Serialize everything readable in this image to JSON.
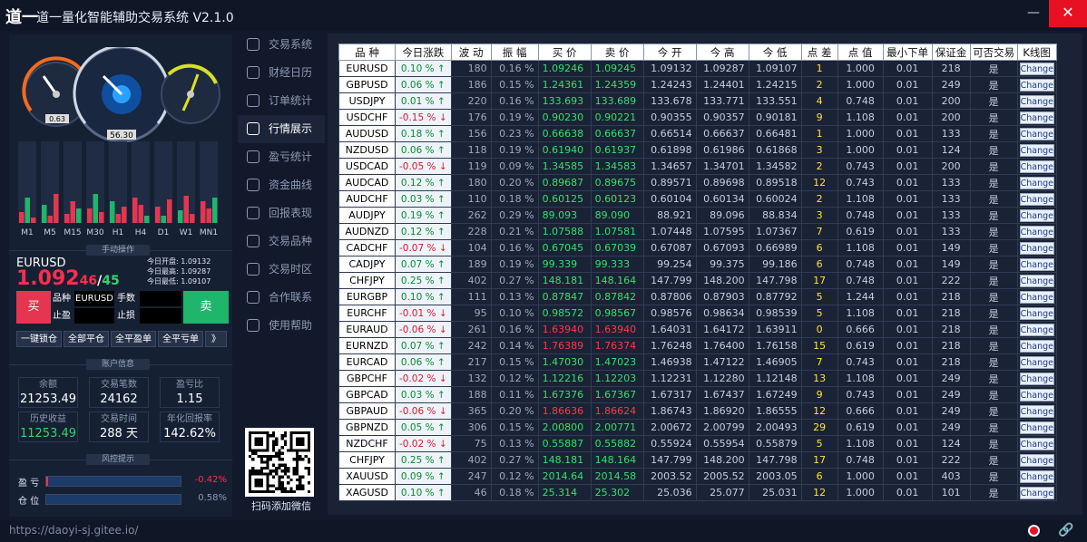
{
  "app": {
    "logo_text": "道一",
    "title": "道一量化智能辅助交易系统 V2.1.0",
    "min": "—",
    "close": "✕"
  },
  "gauges": {
    "left_value": "0.63",
    "mid_value": "56.30"
  },
  "timeframes": [
    "M1",
    "M5",
    "M15",
    "M30",
    "H1",
    "H4",
    "D1",
    "W1",
    "MN1"
  ],
  "trade_panel": {
    "header": "手动操作",
    "symbol": "EURUSD",
    "price_main": "1.092",
    "price_sub1": "46",
    "price_sep": "/",
    "price_sub2": "45",
    "day_open_label": "今日开盘: 1.09132",
    "day_high_label": "今日最高: 1.09287",
    "day_low_label": "今日最低: 1.09107",
    "buy": "买",
    "sell": "卖",
    "symbol_label": "品种",
    "symbol_value": "EURUSD",
    "lots_label": "手数",
    "tp_label": "止盈",
    "sl_label": "止损",
    "ops": [
      "一键锁仓",
      "全部平仓",
      "全平盈单",
      "全平亏单",
      "》"
    ]
  },
  "account": {
    "header": "账户信息",
    "stats": [
      {
        "k": "余额",
        "v": "21253.49",
        "green": false
      },
      {
        "k": "交易笔数",
        "v": "24162",
        "green": false
      },
      {
        "k": "盈亏比",
        "v": "1.15",
        "green": false
      },
      {
        "k": "历史收益",
        "v": "11253.49",
        "green": true
      },
      {
        "k": "交易时间",
        "v": "288 天",
        "green": false
      },
      {
        "k": "年化回报率",
        "v": "142.62%",
        "green": false
      }
    ]
  },
  "risk": {
    "header": "风控提示",
    "pl_label": "盈 亏",
    "pl_value": "-0.42%",
    "pl_color": "#ff2d4d",
    "pos_label": "仓 位",
    "pos_value": "0.58%",
    "pos_color": "#8d9bb5"
  },
  "nav": [
    "交易系统",
    "财经日历",
    "订单统计",
    "行情展示",
    "盈亏统计",
    "资金曲线",
    "回报表现",
    "交易品种",
    "交易时区",
    "合作联系",
    "使用帮助"
  ],
  "nav_active": 3,
  "qr_caption": "扫码添加微信",
  "table": {
    "headers": [
      "品 种",
      "今日涨跌",
      "波 动",
      "振 幅",
      "买 价",
      "卖 价",
      "今 开",
      "今 高",
      "今 低",
      "点 差",
      "点 值",
      "最小下单",
      "保证金",
      "可否交易",
      "K线图"
    ],
    "change_label": "Change",
    "rows": [
      [
        "EURUSD",
        "0.10 % ↑",
        "180",
        "0.16 %",
        "1.09246",
        "1.09245",
        "1.09132",
        "1.09287",
        "1.09107",
        "1",
        "1.000",
        "0.01",
        "218",
        "是"
      ],
      [
        "GBPUSD",
        "0.06 % ↑",
        "186",
        "0.15 %",
        "1.24361",
        "1.24359",
        "1.24243",
        "1.24401",
        "1.24215",
        "2",
        "1.000",
        "0.01",
        "249",
        "是"
      ],
      [
        "USDJPY",
        "0.01 % ↑",
        "220",
        "0.16 %",
        "133.693",
        "133.689",
        "133.678",
        "133.771",
        "133.551",
        "4",
        "0.748",
        "0.01",
        "200",
        "是"
      ],
      [
        "USDCHF",
        "-0.15 % ↓",
        "176",
        "0.19 %",
        "0.90230",
        "0.90221",
        "0.90355",
        "0.90357",
        "0.90181",
        "9",
        "1.108",
        "0.01",
        "200",
        "是"
      ],
      [
        "AUDUSD",
        "0.18 % ↑",
        "156",
        "0.23 %",
        "0.66638",
        "0.66637",
        "0.66514",
        "0.66637",
        "0.66481",
        "1",
        "1.000",
        "0.01",
        "133",
        "是"
      ],
      [
        "NZDUSD",
        "0.06 % ↑",
        "118",
        "0.19 %",
        "0.61940",
        "0.61937",
        "0.61898",
        "0.61986",
        "0.61868",
        "3",
        "1.000",
        "0.01",
        "124",
        "是"
      ],
      [
        "USDCAD",
        "-0.05 % ↓",
        "119",
        "0.09 %",
        "1.34585",
        "1.34583",
        "1.34657",
        "1.34701",
        "1.34582",
        "2",
        "0.743",
        "0.01",
        "200",
        "是"
      ],
      [
        "AUDCAD",
        "0.12 % ↑",
        "180",
        "0.20 %",
        "0.89687",
        "0.89675",
        "0.89571",
        "0.89698",
        "0.89518",
        "12",
        "0.743",
        "0.01",
        "133",
        "是"
      ],
      [
        "AUDCHF",
        "0.03 % ↑",
        "110",
        "0.18 %",
        "0.60125",
        "0.60123",
        "0.60104",
        "0.60134",
        "0.60024",
        "2",
        "1.108",
        "0.01",
        "133",
        "是"
      ],
      [
        "AUDJPY",
        "0.19 % ↑",
        "262",
        "0.29 %",
        "89.093",
        "89.090",
        "88.921",
        "89.096",
        "88.834",
        "3",
        "0.748",
        "0.01",
        "133",
        "是"
      ],
      [
        "AUDNZD",
        "0.12 % ↑",
        "228",
        "0.21 %",
        "1.07588",
        "1.07581",
        "1.07448",
        "1.07595",
        "1.07367",
        "7",
        "0.619",
        "0.01",
        "133",
        "是"
      ],
      [
        "CADCHF",
        "-0.07 % ↓",
        "104",
        "0.16 %",
        "0.67045",
        "0.67039",
        "0.67087",
        "0.67093",
        "0.66989",
        "6",
        "1.108",
        "0.01",
        "149",
        "是"
      ],
      [
        "CADJPY",
        "0.07 % ↑",
        "189",
        "0.19 %",
        "99.339",
        "99.333",
        "99.254",
        "99.375",
        "99.186",
        "6",
        "0.748",
        "0.01",
        "149",
        "是"
      ],
      [
        "CHFJPY",
        "0.25 % ↑",
        "402",
        "0.27 %",
        "148.181",
        "148.164",
        "147.799",
        "148.200",
        "147.798",
        "17",
        "0.748",
        "0.01",
        "222",
        "是"
      ],
      [
        "EURGBP",
        "0.10 % ↑",
        "111",
        "0.13 %",
        "0.87847",
        "0.87842",
        "0.87806",
        "0.87903",
        "0.87792",
        "5",
        "1.244",
        "0.01",
        "218",
        "是"
      ],
      [
        "EURCHF",
        "-0.01 % ↓",
        "95",
        "0.10 %",
        "0.98572",
        "0.98567",
        "0.98576",
        "0.98634",
        "0.98539",
        "5",
        "1.108",
        "0.01",
        "218",
        "是"
      ],
      [
        "EURAUD",
        "-0.06 % ↓",
        "261",
        "0.16 %",
        "1.63940",
        "1.63940",
        "1.64031",
        "1.64172",
        "1.63911",
        "0",
        "0.666",
        "0.01",
        "218",
        "是"
      ],
      [
        "EURNZD",
        "0.07 % ↑",
        "242",
        "0.14 %",
        "1.76389",
        "1.76374",
        "1.76248",
        "1.76400",
        "1.76158",
        "15",
        "0.619",
        "0.01",
        "218",
        "是"
      ],
      [
        "EURCAD",
        "0.06 % ↑",
        "217",
        "0.15 %",
        "1.47030",
        "1.47023",
        "1.46938",
        "1.47122",
        "1.46905",
        "7",
        "0.743",
        "0.01",
        "218",
        "是"
      ],
      [
        "GBPCHF",
        "-0.02 % ↓",
        "132",
        "0.12 %",
        "1.12216",
        "1.12203",
        "1.12231",
        "1.12280",
        "1.12148",
        "13",
        "1.108",
        "0.01",
        "249",
        "是"
      ],
      [
        "GBPCAD",
        "0.03 % ↑",
        "188",
        "0.11 %",
        "1.67376",
        "1.67367",
        "1.67317",
        "1.67437",
        "1.67249",
        "9",
        "0.743",
        "0.01",
        "249",
        "是"
      ],
      [
        "GBPAUD",
        "-0.06 % ↓",
        "365",
        "0.20 %",
        "1.86636",
        "1.86624",
        "1.86743",
        "1.86920",
        "1.86555",
        "12",
        "0.666",
        "0.01",
        "249",
        "是"
      ],
      [
        "GBPNZD",
        "0.05 % ↑",
        "306",
        "0.15 %",
        "2.00800",
        "2.00771",
        "2.00672",
        "2.00799",
        "2.00493",
        "29",
        "0.619",
        "0.01",
        "249",
        "是"
      ],
      [
        "NZDCHF",
        "-0.02 % ↓",
        "75",
        "0.13 %",
        "0.55887",
        "0.55882",
        "0.55924",
        "0.55954",
        "0.55879",
        "5",
        "1.108",
        "0.01",
        "124",
        "是"
      ],
      [
        "CHFJPY",
        "0.25 % ↑",
        "402",
        "0.27 %",
        "148.181",
        "148.164",
        "147.799",
        "148.200",
        "147.798",
        "17",
        "0.748",
        "0.01",
        "222",
        "是"
      ],
      [
        "XAUUSD",
        "0.09 % ↑",
        "247",
        "0.12 %",
        "2014.64",
        "2014.58",
        "2003.52",
        "2005.52",
        "2003.05",
        "6",
        "1.000",
        "0.01",
        "403",
        "是"
      ],
      [
        "XAGUSD",
        "0.10 % ↑",
        "46",
        "0.18 %",
        "25.314",
        "25.302",
        "25.036",
        "25.077",
        "25.031",
        "12",
        "1.000",
        "0.01",
        "101",
        "是"
      ]
    ],
    "red_price_rows": [
      16,
      17,
      21
    ]
  },
  "footer": {
    "url": "https://daoyi-sj.gitee.io/"
  },
  "colors": {
    "up": "#0a8a2d",
    "down": "#d11a2a",
    "buy_green": "#34e06b",
    "spread_yellow": "#ffe23a"
  }
}
